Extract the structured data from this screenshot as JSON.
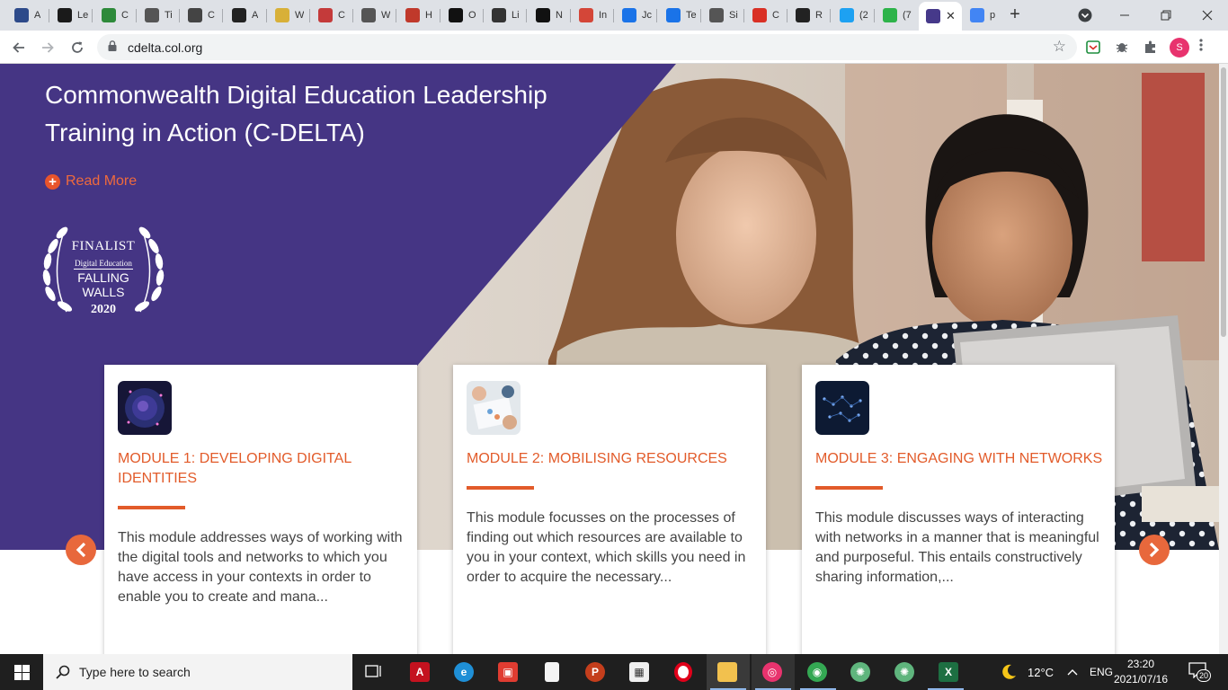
{
  "browser": {
    "tabs": [
      {
        "label": "A",
        "icon": "shield-icon",
        "color": "#2d4a8a"
      },
      {
        "label": "Le",
        "icon": "x-logo-icon",
        "color": "#1a1a1a"
      },
      {
        "label": "C",
        "icon": "w-logo-icon",
        "color": "#2d8a3a"
      },
      {
        "label": "Ti",
        "icon": "u-logo-icon",
        "color": "#555555"
      },
      {
        "label": "C",
        "icon": "gear-icon",
        "color": "#444444"
      },
      {
        "label": "A",
        "icon": "diamond-icon",
        "color": "#222222"
      },
      {
        "label": "W",
        "icon": "shield-yellow-icon",
        "color": "#d8b038"
      },
      {
        "label": "C",
        "icon": "crest-icon",
        "color": "#c43a3a"
      },
      {
        "label": "W",
        "icon": "globe-icon",
        "color": "#555555"
      },
      {
        "label": "H",
        "icon": "bookmark-icon",
        "color": "#c0392b"
      },
      {
        "label": "O",
        "icon": "kite-icon",
        "color": "#111111"
      },
      {
        "label": "Li",
        "icon": "wikipedia-icon",
        "color": "#333333"
      },
      {
        "label": "N",
        "icon": "github-icon",
        "color": "#111111"
      },
      {
        "label": "In",
        "icon": "gmail-icon",
        "color": "#d44638"
      },
      {
        "label": "Jc",
        "icon": "c-logo-icon",
        "color": "#1a73e8"
      },
      {
        "label": "Te",
        "icon": "c-logo-icon",
        "color": "#1a73e8"
      },
      {
        "label": "Si",
        "icon": "globe-icon",
        "color": "#555555"
      },
      {
        "label": "C",
        "icon": "star-red-icon",
        "color": "#d93025"
      },
      {
        "label": "R",
        "icon": "horseshoe-icon",
        "color": "#222222"
      },
      {
        "label": "(2",
        "icon": "twitter-icon",
        "color": "#1da1f2"
      },
      {
        "label": "(7",
        "icon": "question-icon",
        "color": "#2db34a"
      },
      {
        "label": "",
        "icon": "crest-icon",
        "color": "#46398a",
        "active": true
      },
      {
        "label": "p",
        "icon": "google-icon",
        "color": "#4285f4"
      }
    ],
    "new_tab": "+",
    "url": "cdelta.col.org",
    "profile_initial": "S"
  },
  "hero": {
    "title": "Commonwealth Digital Education Leadership Training in Action (C-DELTA)",
    "read_more": "Read More",
    "purple": "#453584",
    "badge": {
      "line1": "FINALIST",
      "line2": "Digital Education",
      "line3": "FALLING",
      "line4": "WALLS",
      "year": "2020"
    }
  },
  "modules": [
    {
      "title": "MODULE 1: DEVELOPING DIGITAL IDENTITIES",
      "desc": "This module addresses ways of working with the digital tools and networks to which you have access in your contexts in order to enable you to create and mana..."
    },
    {
      "title": "MODULE 2: MOBILISING RESOURCES",
      "desc": "This module focusses on the processes of finding out which resources are available to you in your context, which skills you need in order to acquire the necessary..."
    },
    {
      "title": "MODULE 3: ENGAGING WITH NETWORKS",
      "desc": "This module discusses ways of interacting with networks in a manner that is meaningful and purposeful. This entails constructively sharing information,..."
    }
  ],
  "accent": "#e25b2a",
  "taskbar": {
    "search_placeholder": "Type here to search",
    "temperature": "12°C",
    "language": "ENG",
    "time": "23:20",
    "date": "2021/07/16",
    "notifications": "20"
  }
}
